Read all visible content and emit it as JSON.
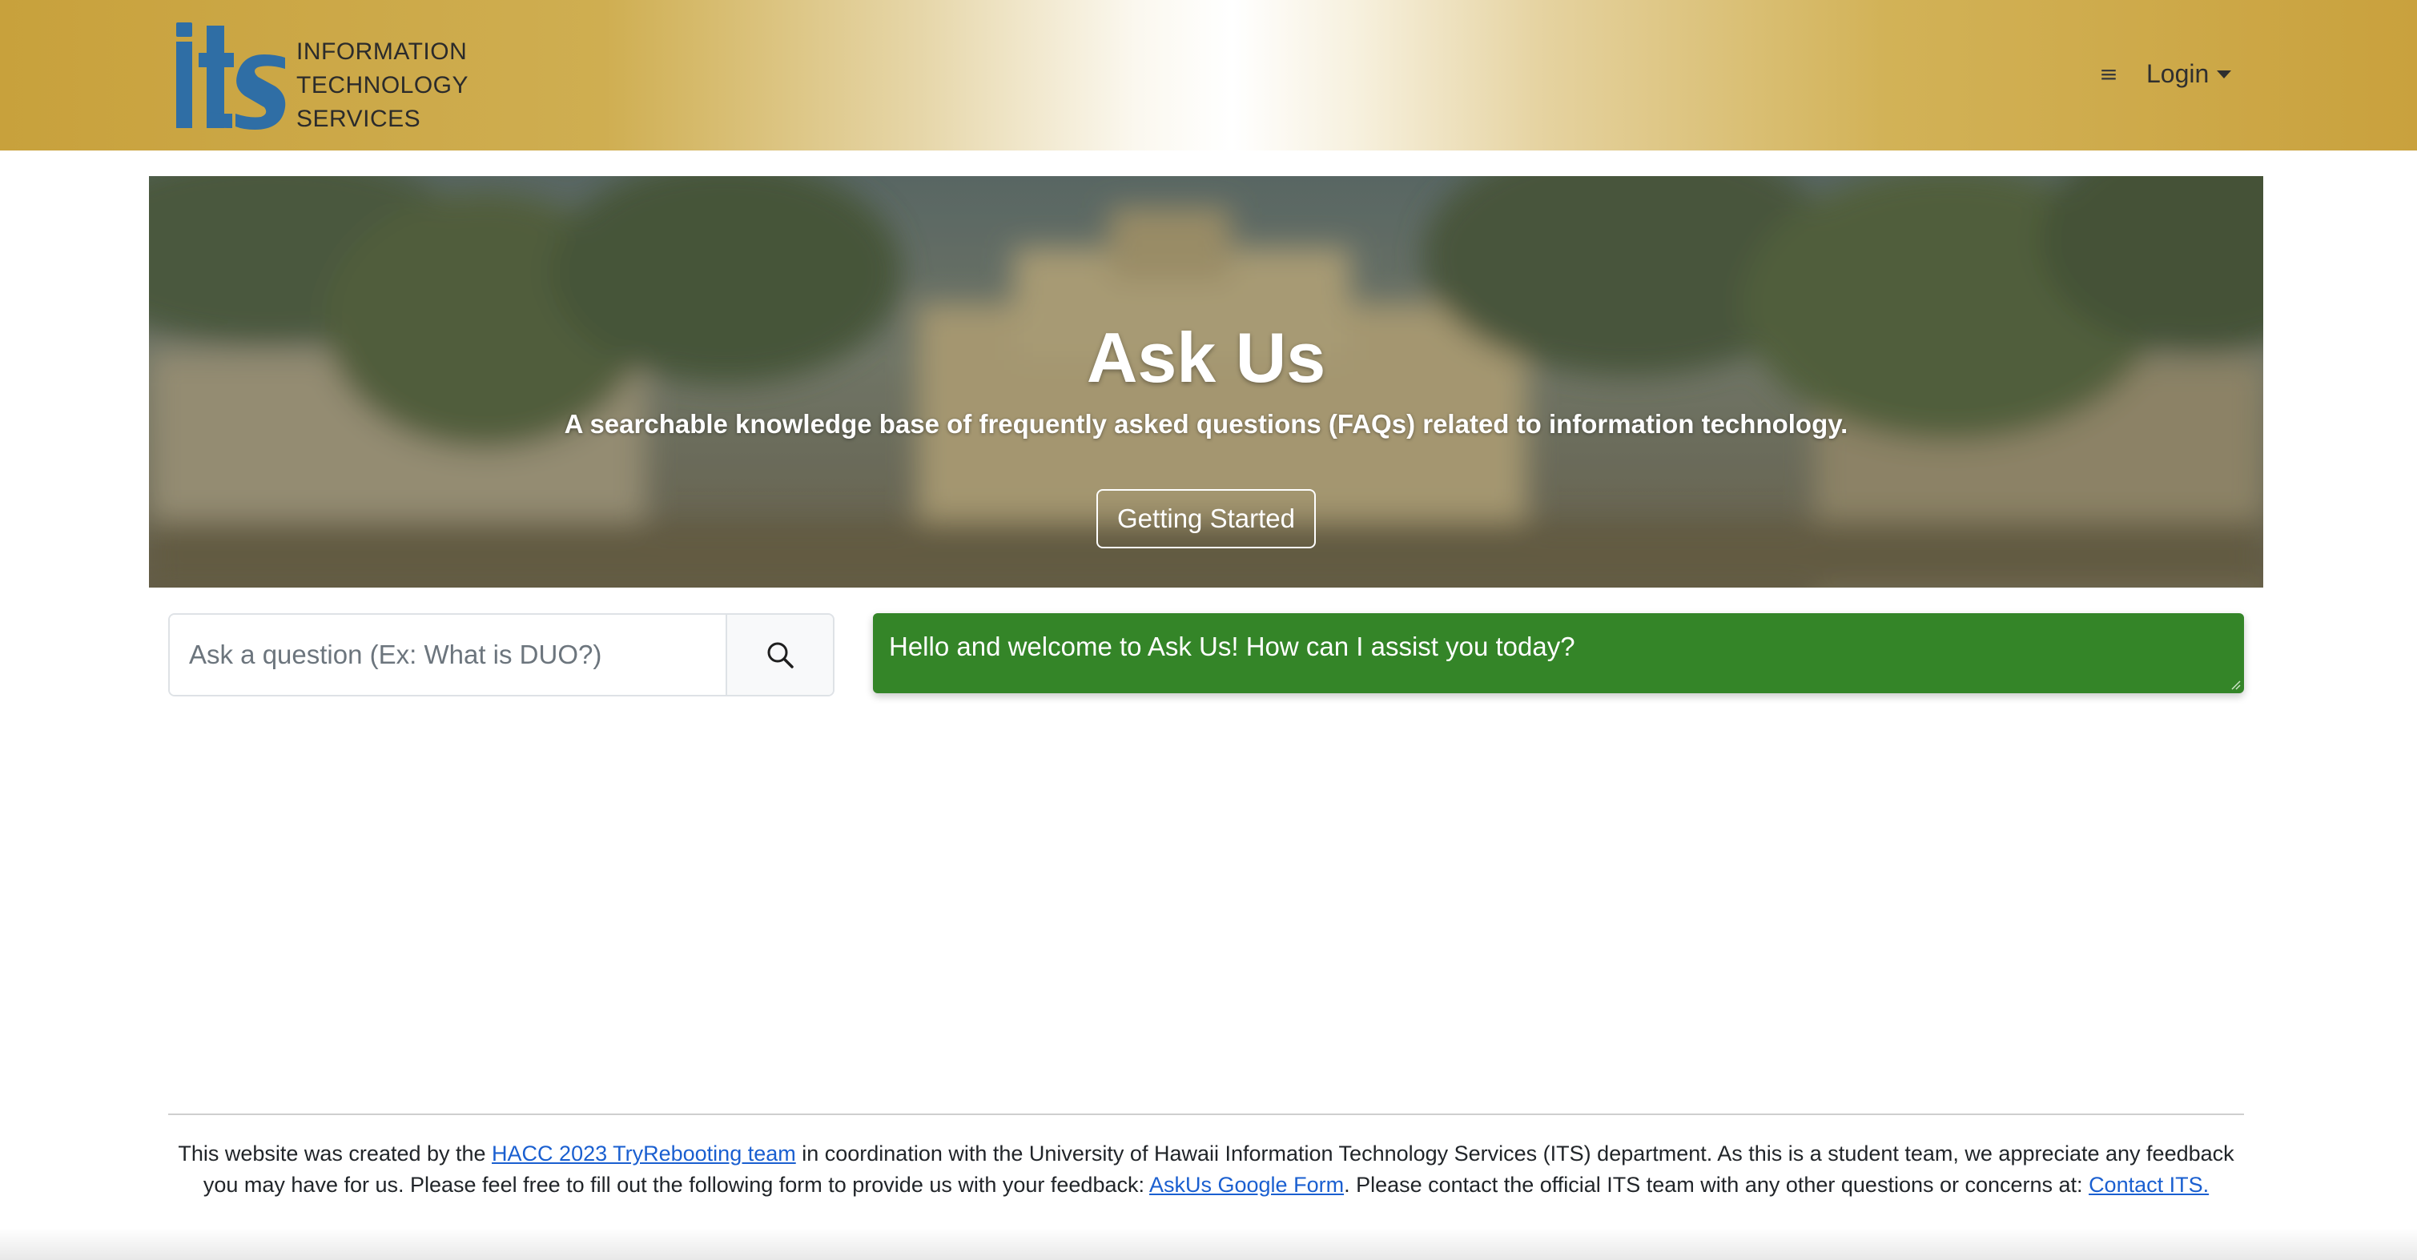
{
  "header": {
    "logo_mark_text": "its",
    "logo_lines": [
      "INFORMATION",
      "TECHNOLOGY",
      "SERVICES"
    ],
    "menu_icon": "hamburger-menu-icon",
    "login_label": "Login"
  },
  "hero": {
    "title": "Ask Us",
    "subtitle": "A searchable knowledge base of frequently asked questions (FAQs) related to information technology.",
    "button_label": "Getting Started"
  },
  "search": {
    "placeholder": "Ask a question (Ex: What is DUO?)",
    "value": "",
    "button_icon": "search-icon"
  },
  "chat": {
    "message": "Hello and welcome to Ask Us! How can I assist you today?"
  },
  "footer": {
    "text_1": "This website was created by the ",
    "link_team": "HACC 2023 TryRebooting team",
    "text_2": " in coordination with the University of Hawaii Information Technology Services (ITS) department. As this is a student team, we appreciate any feedback you may have for us. Please feel free to fill out the following form to provide us with your feedback: ",
    "link_form": "AskUs Google Form",
    "text_3": ". Please contact the official ITS team with any other questions or concerns at: ",
    "link_contact": "Contact ITS."
  },
  "colors": {
    "header_gold": "#c8a13c",
    "logo_blue": "#2f6ea5",
    "chat_green": "#348528",
    "link_blue": "#1a5fd0"
  }
}
